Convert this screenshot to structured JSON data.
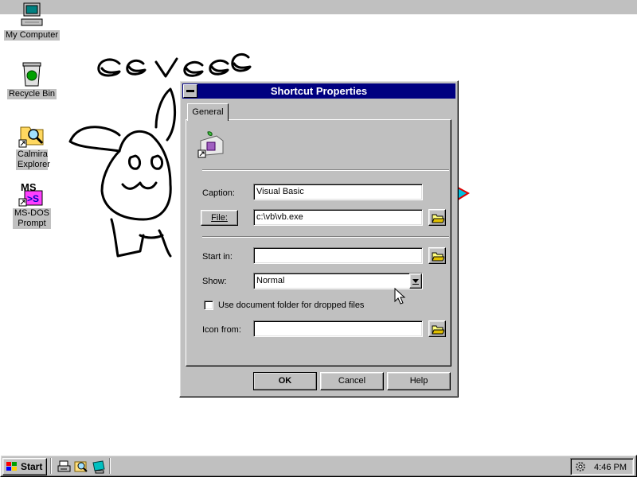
{
  "desktop": {
    "icons": [
      {
        "label": "My Computer",
        "icon": "computer-icon"
      },
      {
        "label": "Recycle Bin",
        "icon": "recycle-bin-icon"
      },
      {
        "label": "Calmira Explorer",
        "icon": "explorer-shortcut-icon"
      },
      {
        "label": "MS-DOS Prompt",
        "icon": "msdos-icon"
      }
    ],
    "doodle_text": "eevee"
  },
  "dialog": {
    "title": "Shortcut Properties",
    "tab": "General",
    "caption_label": "Caption:",
    "caption_value": "Visual Basic",
    "file_button": "File:",
    "file_value": "c:\\vb\\vb.exe",
    "startin_label": "Start in:",
    "startin_value": "",
    "show_label": "Show:",
    "show_value": "Normal",
    "checkbox_label": "Use document folder for dropped files",
    "checkbox_checked": false,
    "iconfrom_label": "Icon from:",
    "iconfrom_value": "",
    "ok": "OK",
    "cancel": "Cancel",
    "help": "Help"
  },
  "taskbar": {
    "start": "Start",
    "quick_launch": [
      "printer-icon",
      "search-icon",
      "monitor-icon"
    ],
    "clock": "4:46 PM"
  },
  "colors": {
    "titlebar": "#000080",
    "face": "#c0c0c0",
    "desktop": "#ffffff"
  }
}
